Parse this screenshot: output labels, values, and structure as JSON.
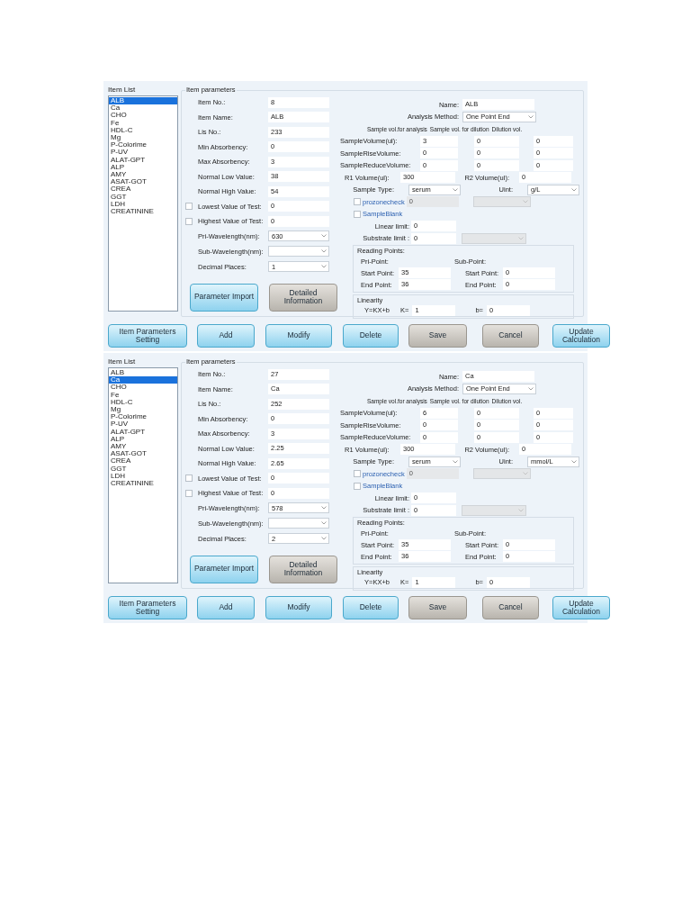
{
  "panels": [
    {
      "item_list": {
        "title": "Item List",
        "items": [
          {
            "label": "ALB",
            "selected": true
          },
          {
            "label": "Ca",
            "selected": false
          },
          {
            "label": "CHO",
            "selected": false
          },
          {
            "label": "Fe",
            "selected": false
          },
          {
            "label": "HDL-C",
            "selected": false
          },
          {
            "label": "Mg",
            "selected": false
          },
          {
            "label": "P-Colorime",
            "selected": false
          },
          {
            "label": "P-UV",
            "selected": false
          },
          {
            "label": "ALAT-GPT",
            "selected": false
          },
          {
            "label": "ALP",
            "selected": false
          },
          {
            "label": "AMY",
            "selected": false
          },
          {
            "label": "ASAT-GOT",
            "selected": false
          },
          {
            "label": "CREA",
            "selected": false
          },
          {
            "label": "GGT",
            "selected": false
          },
          {
            "label": "LDH",
            "selected": false
          },
          {
            "label": "CREATININE",
            "selected": false
          }
        ]
      },
      "params": {
        "title": "Item parameters",
        "fields": [
          {
            "kind": "text",
            "label": "Item No.:",
            "value": "8"
          },
          {
            "kind": "text",
            "label": "Item Name:",
            "value": "ALB"
          },
          {
            "kind": "text",
            "label": "Lis No.:",
            "value": "233"
          },
          {
            "kind": "text",
            "label": "Min Absorbency:",
            "value": "0"
          },
          {
            "kind": "text",
            "label": "Max Absorbency:",
            "value": "3"
          },
          {
            "kind": "text",
            "label": "Normal Low Value:",
            "value": "38"
          },
          {
            "kind": "text",
            "label": "Normal High Value:",
            "value": "54"
          },
          {
            "kind": "check",
            "label": "Lowest Value of Test:",
            "checked": false,
            "value": "0"
          },
          {
            "kind": "check",
            "label": "Highest Value  of Test:",
            "checked": false,
            "value": "0"
          },
          {
            "kind": "select",
            "label": "Pri-Wavelength(nm):",
            "value": "630"
          },
          {
            "kind": "select",
            "label": "Sub-Wavelength(nm):"
          },
          {
            "kind": "select",
            "label": "Decimal Places:",
            "value": "1"
          }
        ],
        "side_buttons": [
          {
            "label": "Parameter Import",
            "kind": "primary"
          },
          {
            "label": "Detailed Information",
            "kind": "disabled"
          }
        ],
        "name": {
          "label": "Name:",
          "value": "ALB"
        },
        "analysis_method": {
          "label": "Analysis Method:",
          "value": "One Point End"
        },
        "volume_headers": [
          "Sample vol.for analysis",
          "Sample vol. for dilution",
          "Dilution vol."
        ],
        "volumes": [
          {
            "label": "SampleVolume(ul):",
            "values": [
              "3",
              "0",
              "0"
            ]
          },
          {
            "label": "SampleRiseVolume:",
            "values": [
              "0",
              "0",
              "0"
            ]
          },
          {
            "label": "SampleReduceVolume:",
            "values": [
              "0",
              "0",
              "0"
            ]
          }
        ],
        "r1": {
          "label": "R1 Volume(ul):",
          "value": "300"
        },
        "r2": {
          "label": "R2 Volume(ul):",
          "value": "0"
        },
        "sample_type": {
          "label": "Sample Type:",
          "value": "serum"
        },
        "unit": {
          "label": "Uint:",
          "value": "g/L"
        },
        "prozone": {
          "label": "prozonecheck",
          "checked": false,
          "value": "0",
          "disabled": true,
          "select_disabled": true
        },
        "sample_blank": {
          "label": "SampleBlank",
          "checked": false
        },
        "linear_limit": {
          "label": "Linear limit:",
          "value": "0"
        },
        "substrate_limit": {
          "label": "Substrate limit :",
          "value": "0",
          "select_disabled": true
        },
        "reading_points": {
          "title": "Reading Points:",
          "groups": [
            {
              "title": "Pri-Point:",
              "start_label": "Start Point:",
              "start": "35",
              "end_label": "End Point:",
              "end": "36"
            },
            {
              "title": "Sub-Point:",
              "start_label": "Start Point:",
              "start": "0",
              "end_label": "End Point:",
              "end": "0"
            }
          ]
        },
        "linearity": {
          "title": "Linearity",
          "formula": "Y=KX+b",
          "k_label": "K=",
          "k": "1",
          "b_label": "b=",
          "b": "0"
        }
      },
      "buttons": [
        {
          "label": "Item Parameters Setting",
          "kind": "primary"
        },
        {
          "label": "Add",
          "kind": "primary"
        },
        {
          "label": "Modify",
          "kind": "primary"
        },
        {
          "label": "Delete",
          "kind": "primary"
        },
        {
          "label": "Save",
          "kind": "disabled"
        },
        {
          "label": "Cancel",
          "kind": "disabled"
        },
        {
          "label": "Update Calculation",
          "kind": "primary"
        }
      ]
    },
    {
      "item_list": {
        "title": "Item List",
        "items": [
          {
            "label": "ALB",
            "selected": false
          },
          {
            "label": "Ca",
            "selected": true
          },
          {
            "label": "CHO",
            "selected": false
          },
          {
            "label": "Fe",
            "selected": false
          },
          {
            "label": "HDL-C",
            "selected": false
          },
          {
            "label": "Mg",
            "selected": false
          },
          {
            "label": "P-Colorime",
            "selected": false
          },
          {
            "label": "P-UV",
            "selected": false
          },
          {
            "label": "ALAT-GPT",
            "selected": false
          },
          {
            "label": "ALP",
            "selected": false
          },
          {
            "label": "AMY",
            "selected": false
          },
          {
            "label": "ASAT-GOT",
            "selected": false
          },
          {
            "label": "CREA",
            "selected": false
          },
          {
            "label": "GGT",
            "selected": false
          },
          {
            "label": "LDH",
            "selected": false
          },
          {
            "label": "CREATININE",
            "selected": false
          }
        ]
      },
      "params": {
        "title": "Item parameters",
        "fields": [
          {
            "kind": "text",
            "label": "Item No.:",
            "value": "27"
          },
          {
            "kind": "text",
            "label": "Item Name:",
            "value": "Ca"
          },
          {
            "kind": "text",
            "label": "Lis No.:",
            "value": "252"
          },
          {
            "kind": "text",
            "label": "Min Absorbency:",
            "value": "0"
          },
          {
            "kind": "text",
            "label": "Max Absorbency:",
            "value": "3"
          },
          {
            "kind": "text",
            "label": "Normal Low Value:",
            "value": "2.25"
          },
          {
            "kind": "text",
            "label": "Normal High Value:",
            "value": "2.65"
          },
          {
            "kind": "check",
            "label": "Lowest Value of Test:",
            "checked": false,
            "value": "0"
          },
          {
            "kind": "check",
            "label": "Highest Value  of Test:",
            "checked": false,
            "value": "0"
          },
          {
            "kind": "select",
            "label": "Pri-Wavelength(nm):",
            "value": "578"
          },
          {
            "kind": "select",
            "label": "Sub-Wavelength(nm):"
          },
          {
            "kind": "select",
            "label": "Decimal Places:",
            "value": "2"
          }
        ],
        "side_buttons": [
          {
            "label": "Parameter Import",
            "kind": "primary"
          },
          {
            "label": "Detailed Information",
            "kind": "disabled"
          }
        ],
        "name": {
          "label": "Name:",
          "value": "Ca"
        },
        "analysis_method": {
          "label": "Analysis Method:",
          "value": "One Point End"
        },
        "volume_headers": [
          "Sample vol.for analysis",
          "Sample vol. for dilution",
          "Dilution vol."
        ],
        "volumes": [
          {
            "label": "SampleVolume(ul):",
            "values": [
              "6",
              "0",
              "0"
            ]
          },
          {
            "label": "SampleRiseVolume:",
            "values": [
              "0",
              "0",
              "0"
            ]
          },
          {
            "label": "SampleReduceVolume:",
            "values": [
              "0",
              "0",
              "0"
            ]
          }
        ],
        "r1": {
          "label": "R1 Volume(ul):",
          "value": "300"
        },
        "r2": {
          "label": "R2 Volume(ul):",
          "value": "0"
        },
        "sample_type": {
          "label": "Sample Type:",
          "value": "serum"
        },
        "unit": {
          "label": "Uint:",
          "value": "mmol/L"
        },
        "prozone": {
          "label": "prozonecheck",
          "checked": false,
          "value": "0",
          "disabled": true,
          "select_disabled": true
        },
        "sample_blank": {
          "label": "SampleBlank",
          "checked": false
        },
        "linear_limit": {
          "label": "Linear limit:",
          "value": "0"
        },
        "substrate_limit": {
          "label": "Substrate limit :",
          "value": "0",
          "select_disabled": true
        },
        "reading_points": {
          "title": "Reading Points:",
          "groups": [
            {
              "title": "Pri-Point:",
              "start_label": "Start Point:",
              "start": "35",
              "end_label": "End Point:",
              "end": "36"
            },
            {
              "title": "Sub-Point:",
              "start_label": "Start Point:",
              "start": "0",
              "end_label": "End Point:",
              "end": "0"
            }
          ]
        },
        "linearity": {
          "title": "Linearity",
          "formula": "Y=KX+b",
          "k_label": "K=",
          "k": "1",
          "b_label": "b=",
          "b": "0"
        }
      },
      "buttons": [
        {
          "label": "Item Parameters Setting",
          "kind": "primary"
        },
        {
          "label": "Add",
          "kind": "primary"
        },
        {
          "label": "Modify",
          "kind": "primary"
        },
        {
          "label": "Delete",
          "kind": "primary"
        },
        {
          "label": "Save",
          "kind": "disabled"
        },
        {
          "label": "Cancel",
          "kind": "disabled"
        },
        {
          "label": "Update Calculation",
          "kind": "primary"
        }
      ]
    }
  ]
}
